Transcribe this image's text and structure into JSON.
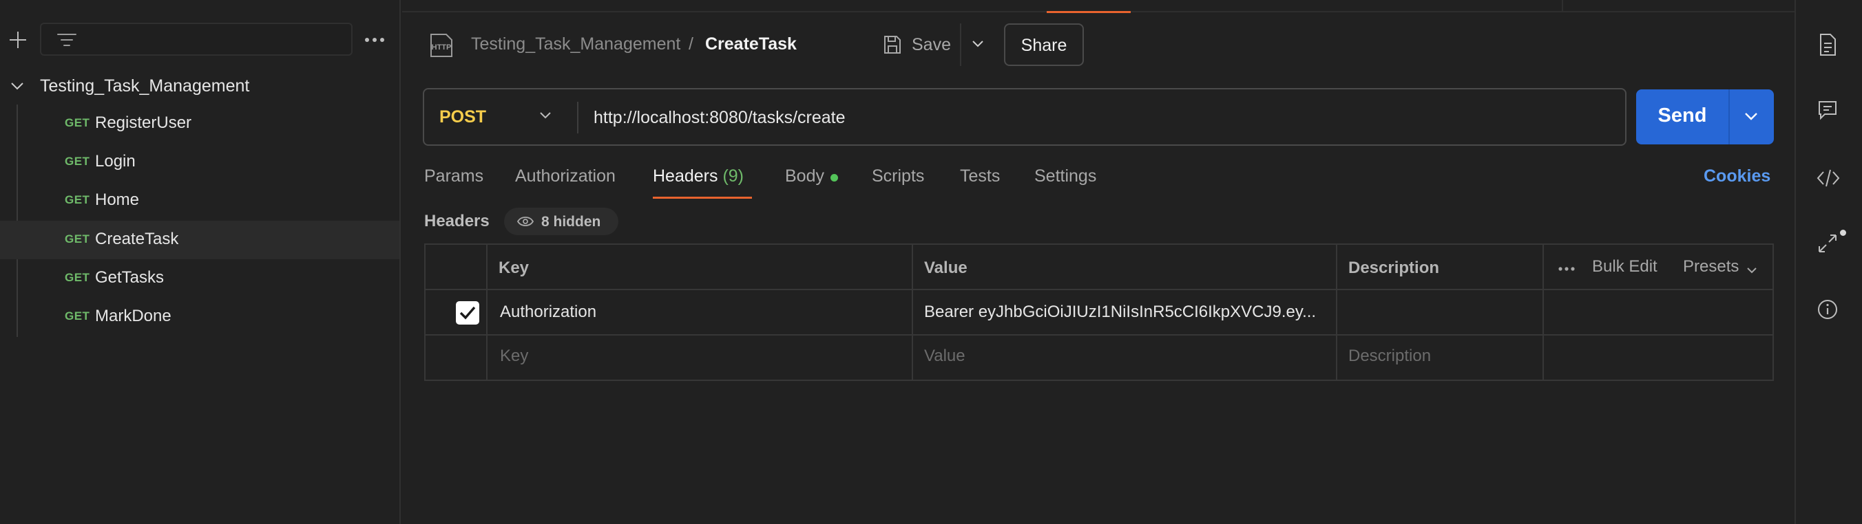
{
  "sidebar": {
    "collection": "Testing_Task_Management",
    "requests": [
      {
        "method": "GET",
        "name": "RegisterUser"
      },
      {
        "method": "GET",
        "name": "Login"
      },
      {
        "method": "GET",
        "name": "Home"
      },
      {
        "method": "GET",
        "name": "CreateTask",
        "active": true
      },
      {
        "method": "GET",
        "name": "GetTasks"
      },
      {
        "method": "GET",
        "name": "MarkDone"
      }
    ]
  },
  "header": {
    "breadcrumb_parent": "Testing_Task_Management",
    "breadcrumb_separator": "/",
    "breadcrumb_current": "CreateTask",
    "save_label": "Save",
    "share_label": "Share"
  },
  "request": {
    "method": "POST",
    "url": "http://localhost:8080/tasks/create",
    "send_label": "Send"
  },
  "tabs": {
    "params": "Params",
    "authorization": "Authorization",
    "headers": "Headers",
    "headers_count": "(9)",
    "body": "Body",
    "scripts": "Scripts",
    "tests": "Tests",
    "settings": "Settings",
    "cookies": "Cookies"
  },
  "headers_section": {
    "title": "Headers",
    "hidden_label": "8 hidden",
    "columns": {
      "key": "Key",
      "value": "Value",
      "description": "Description"
    },
    "bulk_edit": "Bulk Edit",
    "presets": "Presets",
    "rows": [
      {
        "key": "Authorization",
        "value": "Bearer eyJhbGciOiJIUzI1NiIsInR5cCI6IkpXVCJ9.ey...",
        "description": "",
        "checked": true
      }
    ],
    "placeholders": {
      "key": "Key",
      "value": "Value",
      "description": "Description"
    }
  },
  "colors": {
    "accent_orange": "#e8632e",
    "send_blue": "#2767d6",
    "method_post": "#f6cd4c",
    "method_get": "#6fba6a",
    "link_blue": "#5a9af0"
  },
  "icons": [
    "plus-icon",
    "filter-icon",
    "more-icon",
    "chevron-down-icon",
    "http-icon",
    "save-icon",
    "eye-icon",
    "check-icon",
    "document-icon",
    "comment-icon",
    "code-icon",
    "expand-icon",
    "info-icon"
  ]
}
